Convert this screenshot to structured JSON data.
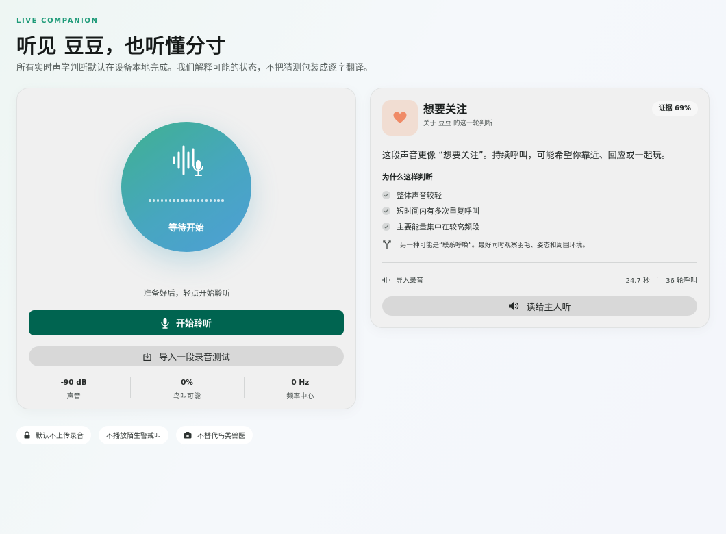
{
  "header": {
    "eyebrow": "LIVE COMPANION",
    "title": "听见 豆豆，也听懂分寸",
    "subtitle": "所有实时声学判断默认在设备本地完成。我们解释可能的状态，不把猜测包装成逐字翻译。"
  },
  "listen_panel": {
    "status": "等待开始",
    "ready_text": "准备好后，轻点开始聆听",
    "start_button": "开始聆听",
    "import_button": "导入一段录音测试",
    "metrics": [
      {
        "value": "-90 dB",
        "label": "声音"
      },
      {
        "value": "0%",
        "label": "鸟叫可能"
      },
      {
        "value": "0 Hz",
        "label": "频率中心"
      }
    ]
  },
  "result_panel": {
    "title": "想要关注",
    "subtitle": "关于 豆豆 的这一轮判断",
    "evidence": "证据 69%",
    "description": "这段声音更像 “想要关注”。持续呼叫，可能希望你靠近、回应或一起玩。",
    "why_title": "为什么这样判断",
    "reasons": [
      "整体声音较轻",
      "短时间内有多次重复呼叫",
      "主要能量集中在较高频段"
    ],
    "alternative": "另一种可能是“联系呼唤”。最好同时观察羽毛、姿态和周围环境。",
    "source": "导入录音",
    "duration": "24.7 秒",
    "separator": "·",
    "calls": "36 轮呼叫",
    "read_button": "读给主人听"
  },
  "chips": [
    {
      "label": "默认不上传录音",
      "icon": "lock-icon"
    },
    {
      "label": "不播放陌生警戒叫",
      "icon": "none"
    },
    {
      "label": "不替代鸟类兽医",
      "icon": "medical-kit-icon"
    }
  ],
  "colors": {
    "accent": "#006450",
    "eyebrow": "#1e9a78",
    "heart": "#f08a66"
  }
}
